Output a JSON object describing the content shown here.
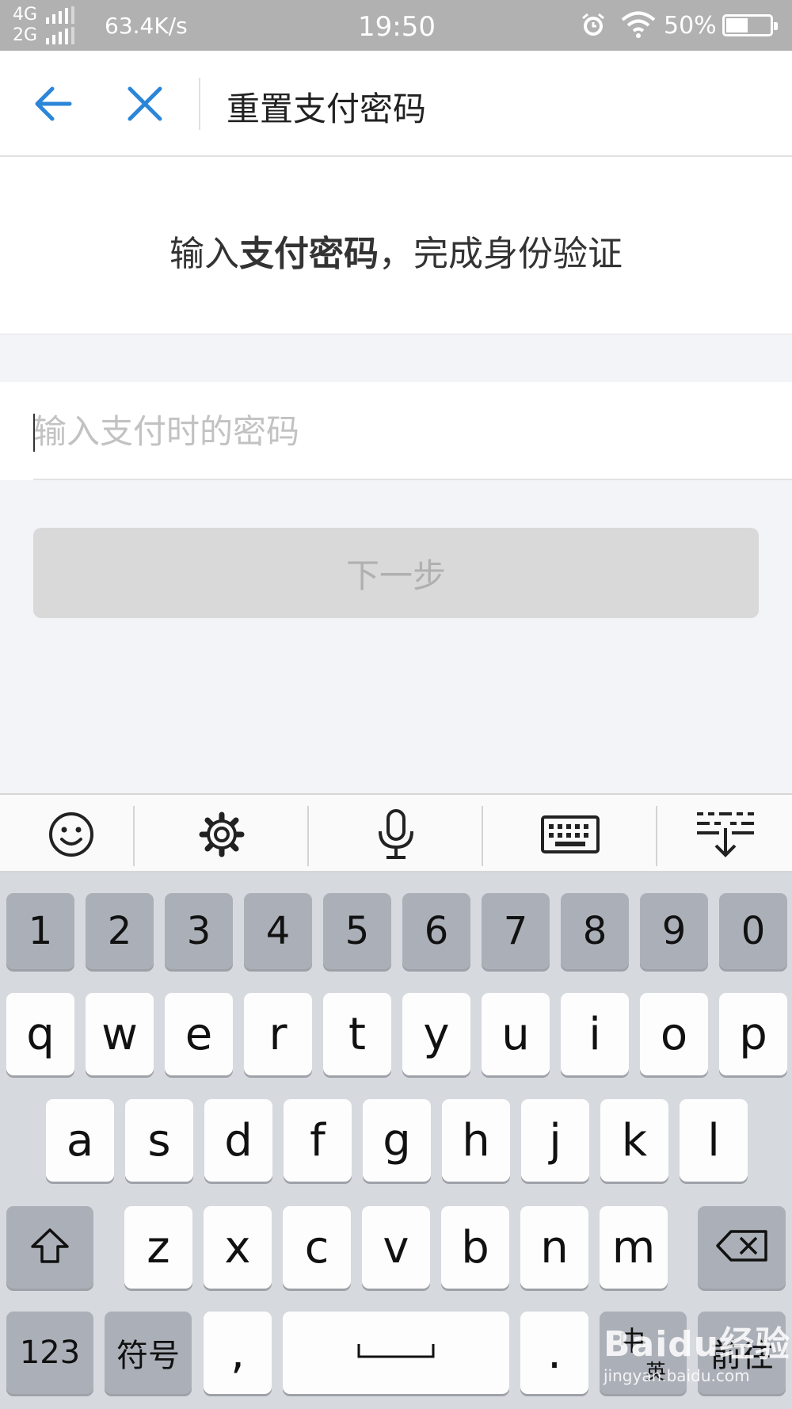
{
  "status_bar": {
    "network_top": "4G",
    "network_bottom": "2G",
    "speed": "63.4K/s",
    "time": "19:50",
    "battery_pct": "50%",
    "battery_level": 0.5
  },
  "header": {
    "title": "重置支付密码",
    "back_icon": "arrow-left-icon",
    "close_icon": "close-icon"
  },
  "prompt": {
    "prefix": "输入",
    "emphasis": "支付密码",
    "suffix": "，完成身份验证"
  },
  "password_input": {
    "placeholder": "输入支付时的密码",
    "value": ""
  },
  "next_button": {
    "label": "下一步",
    "enabled": false
  },
  "keyboard_toolbar": [
    {
      "name": "emoji-icon"
    },
    {
      "name": "gear-icon"
    },
    {
      "name": "microphone-icon"
    },
    {
      "name": "keyboard-icon"
    },
    {
      "name": "collapse-keyboard-icon"
    }
  ],
  "keyboard": {
    "numbers": [
      "1",
      "2",
      "3",
      "4",
      "5",
      "6",
      "7",
      "8",
      "9",
      "0"
    ],
    "row1": [
      "q",
      "w",
      "e",
      "r",
      "t",
      "y",
      "u",
      "i",
      "o",
      "p"
    ],
    "row2": [
      "a",
      "s",
      "d",
      "f",
      "g",
      "h",
      "j",
      "k",
      "l"
    ],
    "row3": [
      "z",
      "x",
      "c",
      "v",
      "b",
      "n",
      "m"
    ],
    "bottom": {
      "mode_123": "123",
      "symbols": "符号",
      "comma": ",",
      "period": ".",
      "lang_top": "中",
      "lang_bottom": "英",
      "go": "前往"
    },
    "shift_icon": "shift-icon",
    "backspace_icon": "backspace-icon",
    "space_icon": "space-bar-icon"
  },
  "watermark": {
    "logo": "Baidu经验",
    "url": "jingyan.baidu.com"
  },
  "colors": {
    "accent": "#2b86d9",
    "status_bar": "#b1b1b1",
    "button_disabled": "#d9d9d9"
  }
}
